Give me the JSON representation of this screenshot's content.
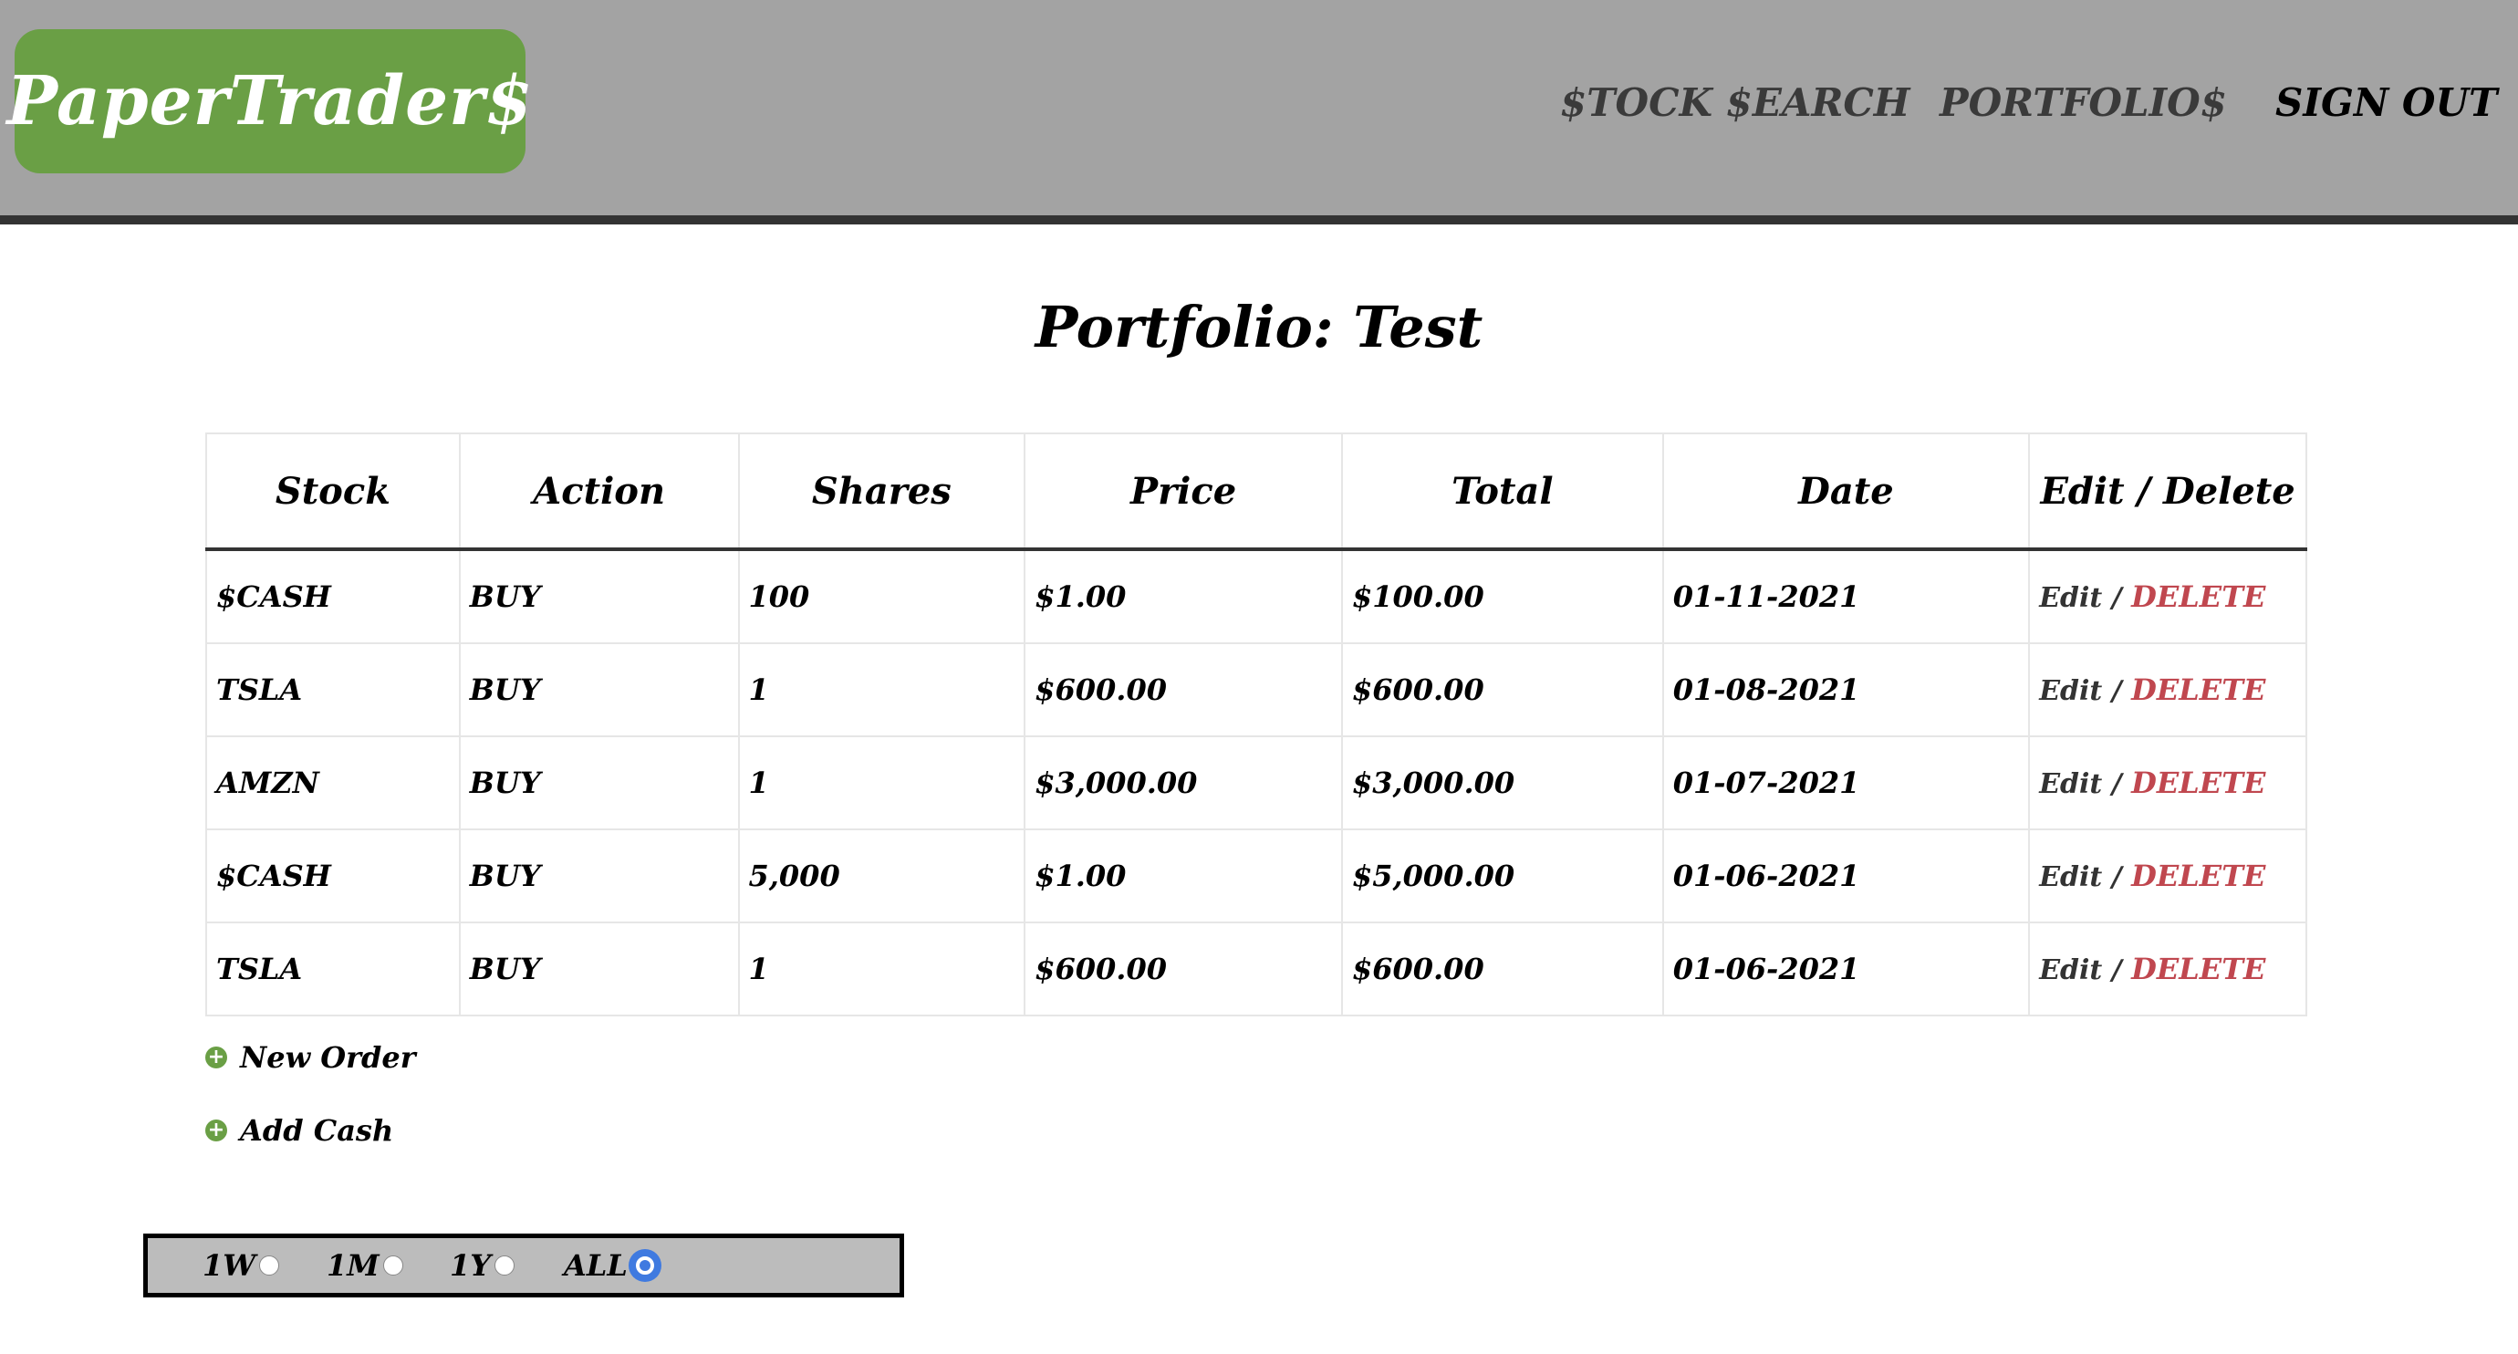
{
  "header": {
    "logo": "PaperTrader$",
    "nav": {
      "stock_search": "$TOCK $EARCH",
      "portfolios": "PORTFOLIO$",
      "sign_out": "SIGN OUT"
    }
  },
  "page": {
    "title": "Portfolio: Test"
  },
  "table": {
    "headers": [
      "Stock",
      "Action",
      "Shares",
      "Price",
      "Total",
      "Date",
      "Edit / Delete"
    ],
    "rows": [
      {
        "stock": "$CASH",
        "action": "BUY",
        "shares": "100",
        "price": "$1.00",
        "total": "$100.00",
        "date": "01-11-2021",
        "edit": "Edit",
        "sep": " / ",
        "delete": "DELETE"
      },
      {
        "stock": "TSLA",
        "action": "BUY",
        "shares": "1",
        "price": "$600.00",
        "total": "$600.00",
        "date": "01-08-2021",
        "edit": "Edit",
        "sep": " / ",
        "delete": "DELETE"
      },
      {
        "stock": "AMZN",
        "action": "BUY",
        "shares": "1",
        "price": "$3,000.00",
        "total": "$3,000.00",
        "date": "01-07-2021",
        "edit": "Edit",
        "sep": " / ",
        "delete": "DELETE"
      },
      {
        "stock": "$CASH",
        "action": "BUY",
        "shares": "5,000",
        "price": "$1.00",
        "total": "$5,000.00",
        "date": "01-06-2021",
        "edit": "Edit",
        "sep": " / ",
        "delete": "DELETE"
      },
      {
        "stock": "TSLA",
        "action": "BUY",
        "shares": "1",
        "price": "$600.00",
        "total": "$600.00",
        "date": "01-06-2021",
        "edit": "Edit",
        "sep": " / ",
        "delete": "DELETE"
      }
    ]
  },
  "actions": {
    "new_order": "New Order",
    "add_cash": "Add Cash"
  },
  "range": {
    "options": [
      "1W",
      "1M",
      "1Y",
      "ALL"
    ],
    "selected": "ALL"
  },
  "colors": {
    "header_bg": "#a3a3a3",
    "logo_bg": "#6a9f45",
    "delete": "#c0474f",
    "radio_selected": "#3f7ae0"
  }
}
